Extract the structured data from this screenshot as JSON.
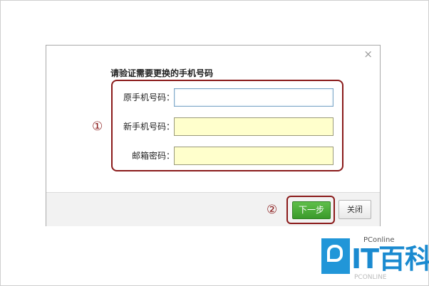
{
  "dialog": {
    "title": "请验证需要更换的手机号码",
    "close_glyph": "×",
    "fields": [
      {
        "label": "原手机号码：",
        "value": "",
        "state": "active"
      },
      {
        "label": "新手机号码：",
        "value": "",
        "state": "filled"
      },
      {
        "label": "邮箱密码：",
        "value": "",
        "state": "filled"
      }
    ],
    "markers": {
      "step1": "①",
      "step2": "②"
    },
    "buttons": {
      "next_label": "下一步",
      "close_label": "关闭"
    }
  },
  "watermark": {
    "sub": "PConline",
    "main": "IT百科",
    "tail": "PCONLINE"
  },
  "colors": {
    "highlight_border": "#8a1a1a",
    "next_button": "#4aae39",
    "input_fill": "#ffffcc",
    "watermark_blue": "#1a8ad0"
  },
  "icons": {
    "close": "close-icon",
    "watermark_logo": "pconline-logo-icon"
  }
}
